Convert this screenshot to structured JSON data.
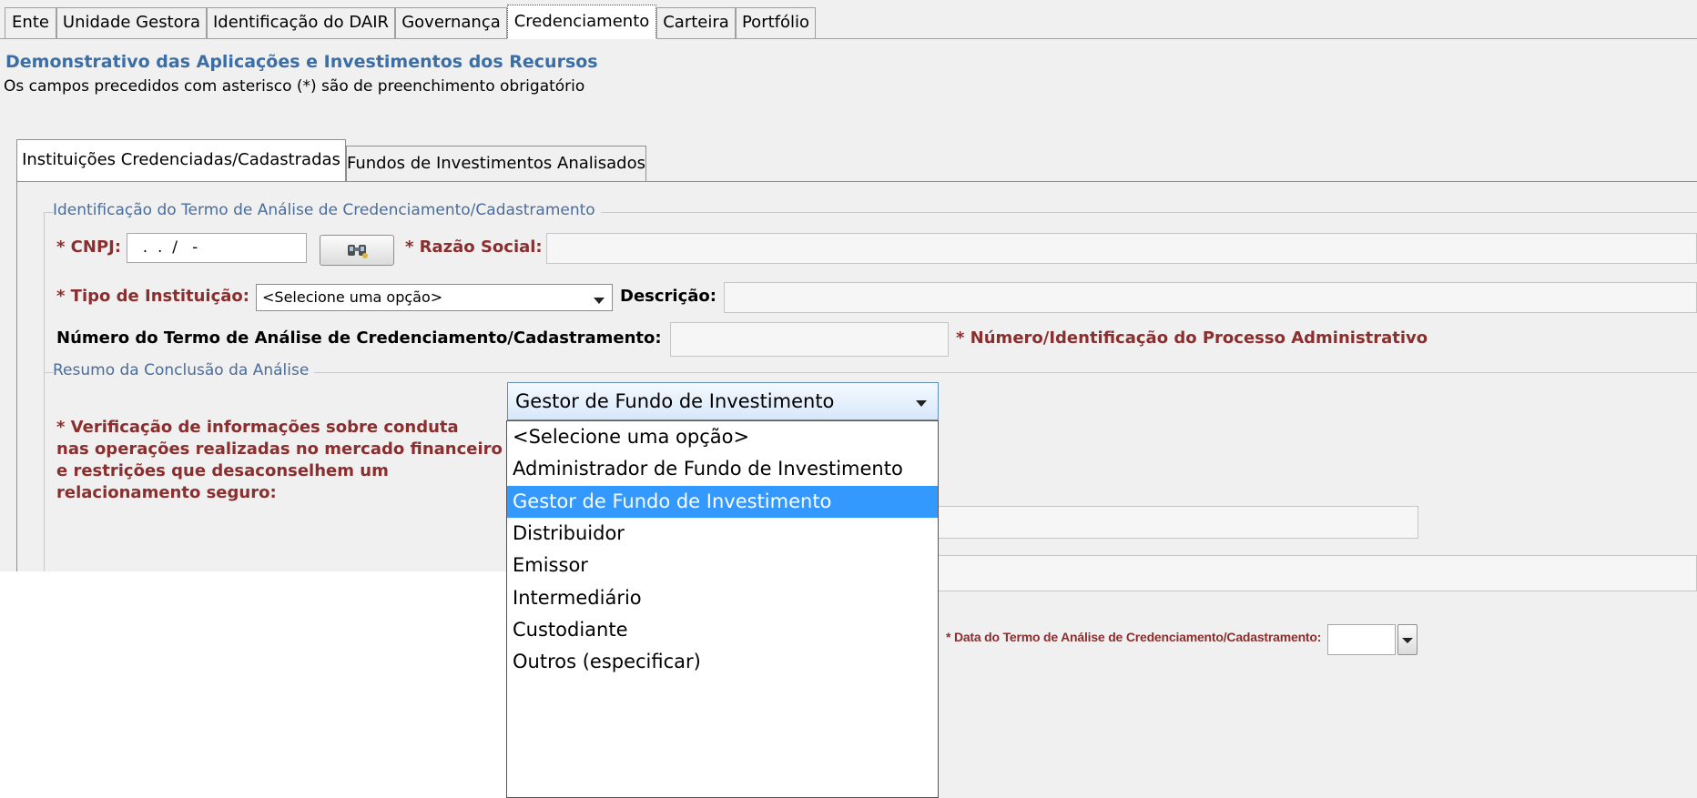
{
  "top_tabs": [
    {
      "label": "Ente"
    },
    {
      "label": "Unidade Gestora"
    },
    {
      "label": "Identificação do DAIR"
    },
    {
      "label": "Governança"
    },
    {
      "label": "Credenciamento"
    },
    {
      "label": "Carteira"
    },
    {
      "label": "Portfólio"
    }
  ],
  "header": {
    "title": "Demonstrativo das Aplicações e Investimentos dos Recursos",
    "subtitle": "Os campos precedidos com asterisco (*) são de preenchimento obrigatório"
  },
  "inner_tabs": [
    {
      "label": "Instituições Credenciadas/Cadastradas"
    },
    {
      "label": "Fundos de Investimentos Analisados"
    }
  ],
  "identificacao": {
    "legend": "Identificação do Termo de Análise de Credenciamento/Cadastramento",
    "cnpj_label": "* CNPJ:",
    "cnpj_value": "  .  .  /   -",
    "razao_label": "* Razão Social:",
    "tipo_label": "* Tipo de Instituição:",
    "tipo_value": "<Selecione uma opção>",
    "descricao_label": "Descrição:",
    "numero_termo_label": "Número do Termo de Análise de Credenciamento/Cadastramento:",
    "numero_processo_label": "* Número/Identificação do Processo Administrativo"
  },
  "resumo": {
    "legend": "Resumo da Conclusão da Análise",
    "verificacao_label_1": "* Verificação de informações sobre conduta",
    "verificacao_label_2": "nas operações realizadas no mercado financeiro",
    "verificacao_label_3": "e restrições que desaconselhem um",
    "verificacao_label_4": "relacionamento seguro:"
  },
  "dropdown": {
    "selected": "Gestor de Fundo de Investimento",
    "options": [
      "<Selecione uma opção>",
      "Administrador de Fundo de Investimento",
      "Gestor de Fundo de Investimento",
      "Distribuidor",
      "Emissor",
      "Intermediário",
      "Custodiante",
      "Outros (especificar)"
    ]
  },
  "data_termo_label": "* Data do Termo de Análise de Credenciamento/Cadastramento:",
  "colors": {
    "title_blue": "#3a6ea5",
    "required_red": "#8b2e2e",
    "selection_blue": "#3399ff"
  }
}
